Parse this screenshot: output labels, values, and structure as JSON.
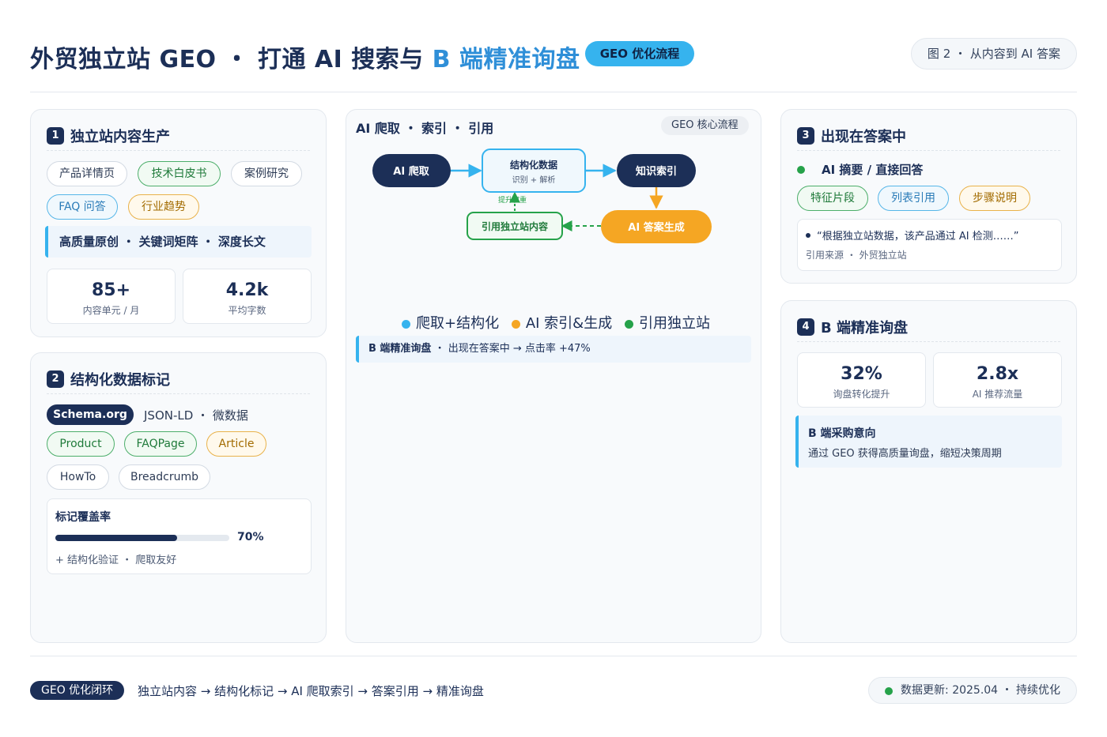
{
  "header": {
    "title_main": "外贸独立站 GEO ・ 打通 AI 搜索与 ",
    "title_accent": "B 端精准询盘",
    "badge": "GEO 优化流程",
    "figure_label": "图 2 ・ 从内容到 AI 答案"
  },
  "card1": {
    "num": "1",
    "title": "独立站内容生产",
    "chips": [
      "产品详情页",
      "技术白皮书",
      "案例研究",
      "FAQ 问答",
      "行业趋势"
    ],
    "callout": "高质量原创 ・ 关键词矩阵 ・ 深度长文",
    "stats": [
      {
        "value": "85+",
        "label": "内容单元 / 月"
      },
      {
        "value": "4.2k",
        "label": "平均字数"
      }
    ]
  },
  "card2": {
    "num": "2",
    "title": "结构化数据标记",
    "schema_badge": "Schema.org",
    "schema_text": "JSON-LD ・ 微数据",
    "chips": [
      "Product",
      "FAQPage",
      "Article",
      "HowTo",
      "Breadcrumb"
    ],
    "coverage": {
      "title": "标记覆盖率",
      "value": 70,
      "value_label": "70%",
      "note": "+ 结构化验证 ・ 爬取友好"
    }
  },
  "middle": {
    "title": "AI 爬取 ・ 索引 ・ 引用",
    "badge": "GEO 核心流程",
    "nodes": {
      "crawl": "AI 爬取",
      "structured": "结构化数据",
      "structured_sub": "识别 + 解析",
      "index": "知识索引",
      "answer": "AI 答案生成",
      "cite": "引用独立站内容"
    },
    "edge_label": "提升权重",
    "legend": [
      {
        "label": "爬取+结构化",
        "color": "#36b3ee"
      },
      {
        "label": "AI 索引&生成",
        "color": "#f5a623"
      },
      {
        "label": "引用独立站",
        "color": "#26a24a"
      }
    ],
    "callout_bold": "B 端精准询盘",
    "callout_text": " ・ 出现在答案中 → 点击率 +47%"
  },
  "card3": {
    "num": "3",
    "title": "出现在答案中",
    "subtitle": "AI 摘要 / 直接回答",
    "chips": [
      "特征片段",
      "列表引用",
      "步骤说明"
    ],
    "quote": "“根据独立站数据，该产品通过 AI 检测……”",
    "source": "引用来源 ・ 外贸独立站"
  },
  "card4": {
    "num": "4",
    "title": "B 端精准询盘",
    "stats": [
      {
        "value": "32%",
        "label": "询盘转化提升"
      },
      {
        "value": "2.8x",
        "label": "AI 推荐流量"
      }
    ],
    "callout_title": "B 端采购意向",
    "callout_text": "通过 GEO 获得高质量询盘，缩短决策周期"
  },
  "footer": {
    "badge": "GEO 优化闭环",
    "text": "独立站内容 → 结构化标记 → AI 爬取索引 → 答案引用 → 精准询盘",
    "update": "数据更新: 2025.04 ・ 持续优化"
  },
  "colors": {
    "navy": "#1c2f57",
    "sky": "#36b3ee",
    "orange": "#f5a623",
    "green": "#26a24a"
  }
}
